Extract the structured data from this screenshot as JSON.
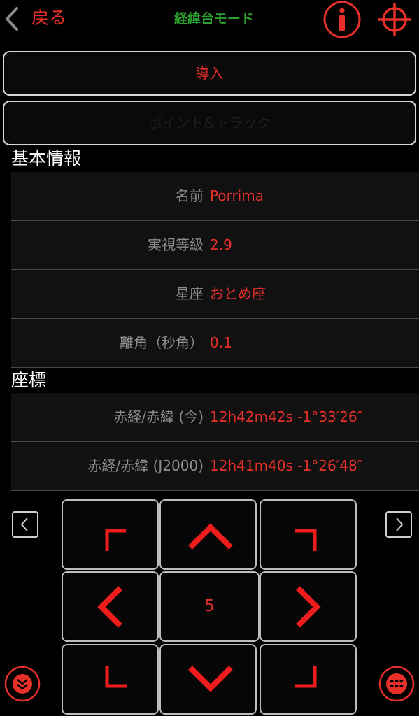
{
  "header": {
    "back_label": "戻る",
    "title": "経緯台モード",
    "info_icon": "info-icon",
    "target_icon": "crosshair-icon"
  },
  "actions": {
    "intro_label": "導入",
    "point_track_label": "ポイント&トラック"
  },
  "basic_info": {
    "section_title": "基本情報",
    "rows": [
      {
        "label": "名前",
        "value": "Porrima"
      },
      {
        "label": "実視等級",
        "value": "2.9"
      },
      {
        "label": "星座",
        "value": "おとめ座"
      },
      {
        "label": "離角（秒角）",
        "value": "0.1"
      }
    ]
  },
  "coordinates": {
    "section_title": "座標",
    "rows": [
      {
        "label": "赤経/赤緯 (今)",
        "value": "12h42m42s -1°33′26″"
      },
      {
        "label": "赤経/赤緯 (J2000)",
        "value": "12h41m40s -1°26′48″"
      }
    ]
  },
  "dpad": {
    "speed": "5",
    "icons": [
      "corner-up-left-icon",
      "arrow-up-icon",
      "corner-up-right-icon",
      "arrow-left-icon",
      "arrow-right-icon",
      "corner-down-left-icon",
      "arrow-down-icon",
      "corner-down-right-icon"
    ]
  },
  "colors": {
    "accent": "#e8302a",
    "title_green": "#2ea02e",
    "background": "#000000"
  }
}
